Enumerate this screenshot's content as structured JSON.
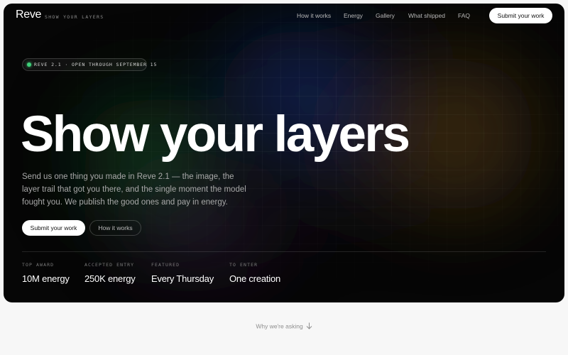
{
  "brand": {
    "logo": "Reve",
    "tagline": "SHOW YOUR LAYERS"
  },
  "nav": {
    "links": [
      "How it works",
      "Energy",
      "Gallery",
      "What shipped",
      "FAQ"
    ],
    "cta": "Submit your work"
  },
  "badge": {
    "icon": "status-dot",
    "text": "REVE 2.1 · OPEN THROUGH SEPTEMBER 15",
    "color": "#3fd07a"
  },
  "hero": {
    "title": "Show your layers",
    "lede": "Send us one thing you made in Reve 2.1 — the image, the layer trail that got you there, and the single moment the model fought you. We publish the good ones and pay in energy.",
    "primary_cta": "Submit your work",
    "secondary_cta": "How it works"
  },
  "stats": [
    {
      "label": "TOP AWARD",
      "value": "10M energy"
    },
    {
      "label": "ACCEPTED ENTRY",
      "value": "250K energy"
    },
    {
      "label": "FEATURED",
      "value": "Every Thursday"
    },
    {
      "label": "TO ENTER",
      "value": "One creation"
    }
  ],
  "footer": {
    "text": "Why we're asking",
    "icon": "arrow-down-icon"
  },
  "colors": {
    "page_bg": "#f7f7f7",
    "hero_bg": "#060606",
    "accent_green": "#3fd07a"
  }
}
